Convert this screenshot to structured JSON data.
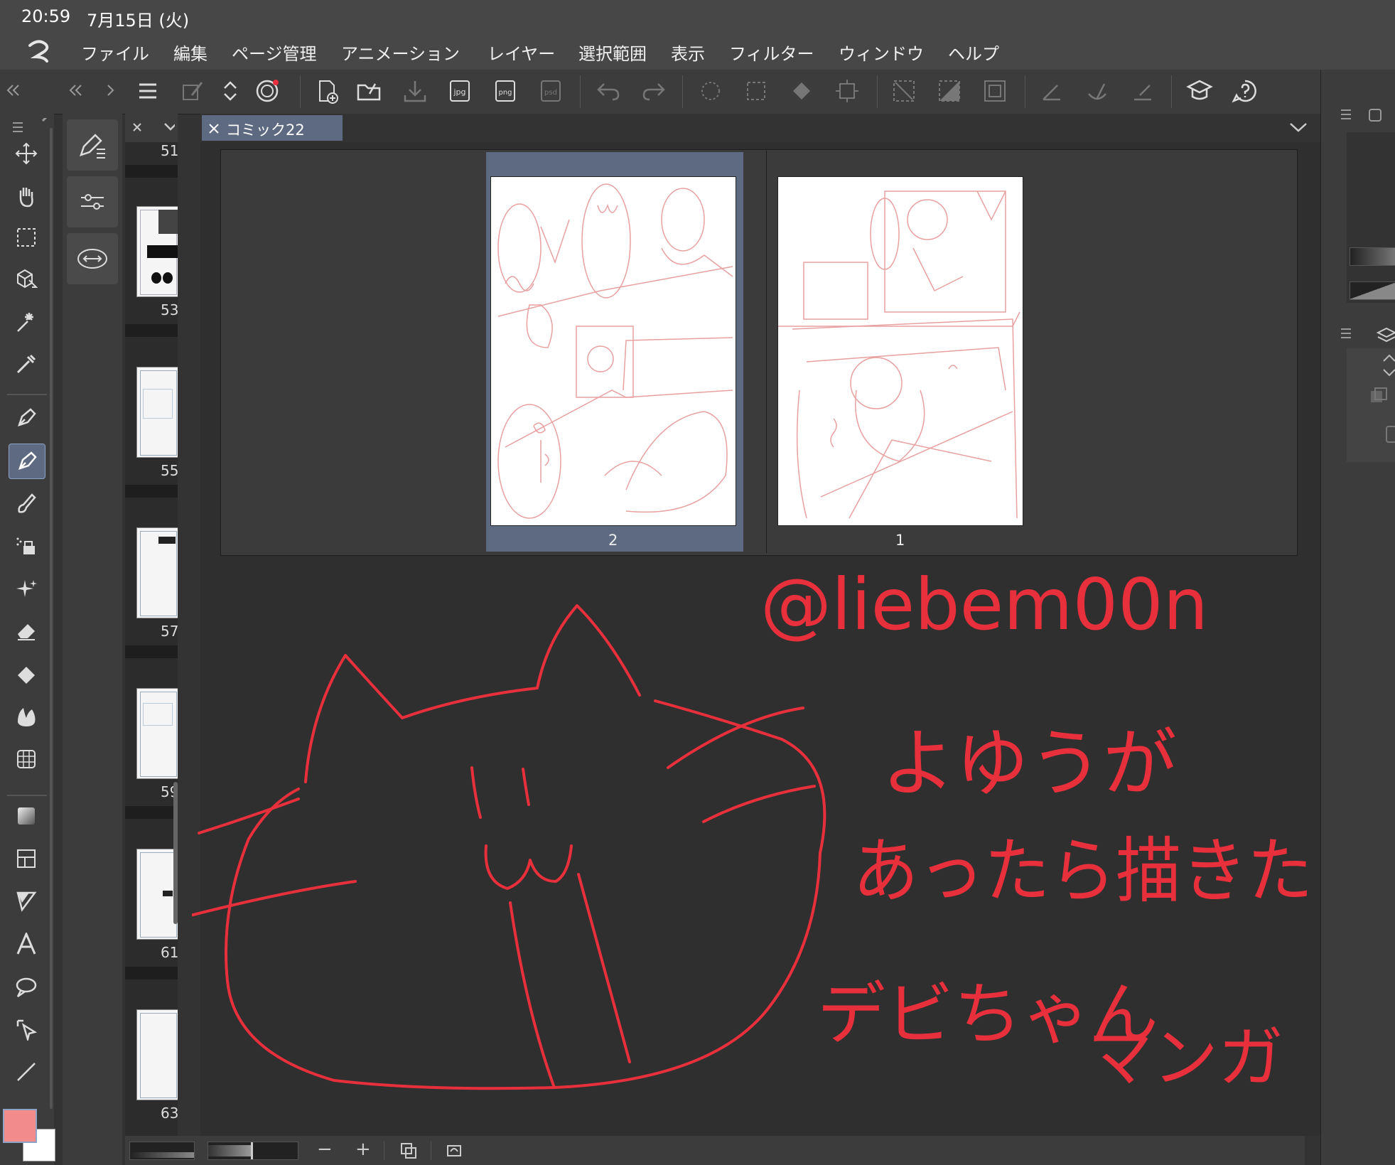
{
  "status": {
    "time": "20:59",
    "date": "7月15日 (火)"
  },
  "menu": {
    "items": [
      "ファイル",
      "編集",
      "ページ管理",
      "アニメーション",
      "レイヤー",
      "選択範囲",
      "表示",
      "フィルター",
      "ウィンドウ",
      "ヘルプ"
    ]
  },
  "toolbar": {
    "icons": [
      "menu-icon",
      "edit-icon",
      "up-down-icon",
      "spiral-icon",
      "new-file-icon",
      "open-folder-icon",
      "save-icon",
      "export-jpg-icon",
      "export-png-icon",
      "export-psd-icon",
      "undo-icon",
      "redo-icon",
      "sparkle-icon",
      "transform-icon",
      "fill-bucket-icon",
      "crop-icon",
      "select-none-icon",
      "invert-selection-icon",
      "show-selection-icon",
      "ruler-icon",
      "ruler-curve-icon",
      "ruler-edit-icon",
      "learn-icon",
      "help-icon"
    ],
    "export_labels": [
      "jpg",
      "png",
      "psd"
    ]
  },
  "tools": [
    "move-icon",
    "hand-icon",
    "marquee-icon",
    "3d-object-icon",
    "magic-wand-icon",
    "eyedropper-icon",
    "pen-icon",
    "pencil-icon",
    "brush-icon",
    "airbrush-icon",
    "decoration-icon",
    "eraser-icon",
    "fill-icon",
    "blend-icon",
    "grid-icon",
    "gradient-icon",
    "frame-icon",
    "ruler-icon",
    "text-icon",
    "balloon-icon",
    "object-select-icon",
    "line-icon"
  ],
  "thumbnails": {
    "numbers": [
      "51",
      "53",
      "55",
      "57",
      "59",
      "61",
      "63"
    ]
  },
  "document": {
    "tab_title": "コミック22",
    "pages": [
      {
        "number": "2",
        "selected": true
      },
      {
        "number": "1",
        "selected": false
      }
    ]
  },
  "handwriting": {
    "username": "@liebem00n",
    "line1": "よゆうが",
    "line2": "あったら描きたい",
    "line3": "デビちゃん",
    "line4": "マンガ"
  },
  "colors": {
    "foreground": "#f28c8c",
    "background": "#ffffff",
    "ink": "#e8303c",
    "sketch": "#e8a0a0",
    "accent": "#5d6a82"
  },
  "bottom": {
    "minus": "−",
    "plus": "+"
  }
}
